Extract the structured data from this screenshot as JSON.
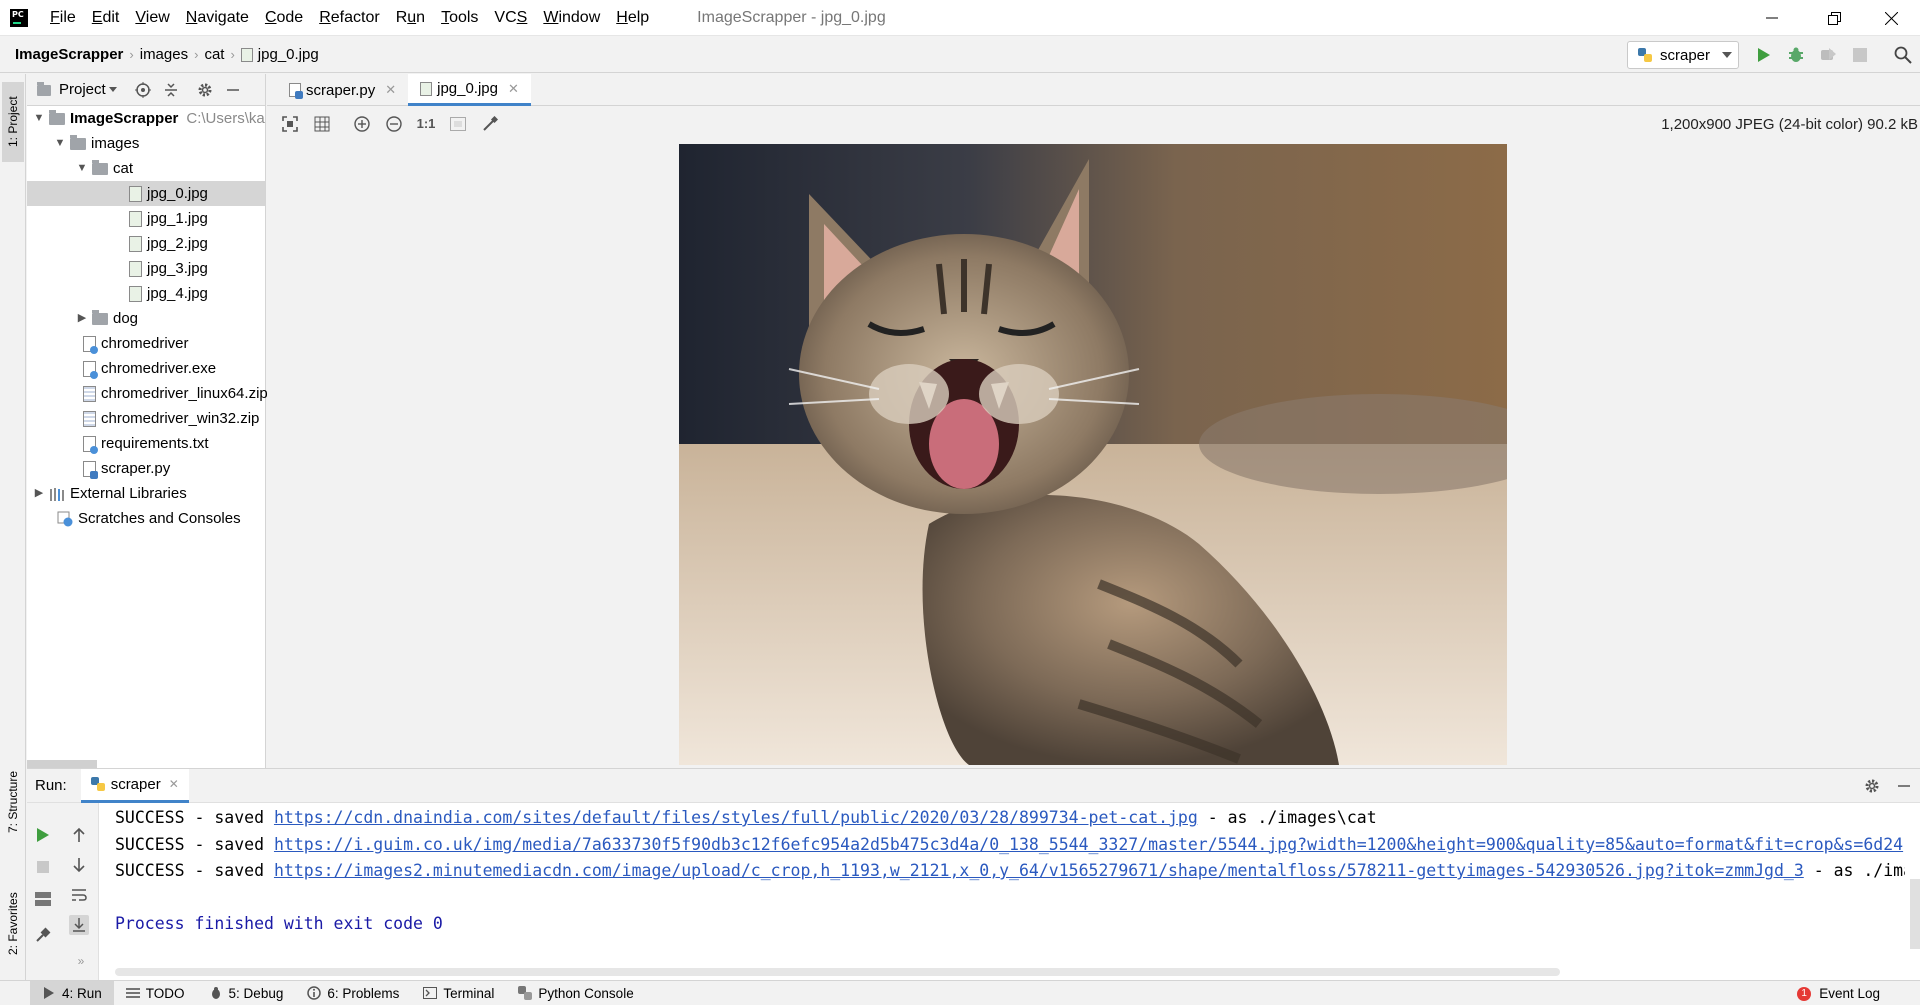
{
  "menu": {
    "items": [
      {
        "label": "File",
        "u": "F"
      },
      {
        "label": "Edit",
        "u": "E"
      },
      {
        "label": "View",
        "u": "V"
      },
      {
        "label": "Navigate",
        "u": "N"
      },
      {
        "label": "Code",
        "u": "C"
      },
      {
        "label": "Refactor",
        "u": "R"
      },
      {
        "label": "Run",
        "u": "u"
      },
      {
        "label": "Tools",
        "u": "T"
      },
      {
        "label": "VCS",
        "u": "S"
      },
      {
        "label": "Window",
        "u": "W"
      },
      {
        "label": "Help",
        "u": "H"
      }
    ],
    "window_title": "ImageScrapper - jpg_0.jpg"
  },
  "breadcrumb": {
    "project": "ImageScrapper",
    "folder1": "images",
    "folder2": "cat",
    "file": "jpg_0.jpg"
  },
  "toolbar": {
    "run_config": "scraper"
  },
  "left_stripe": {
    "project_tab": "1: Project",
    "structure_tab": "7: Structure",
    "favorites_tab": "2: Favorites"
  },
  "project_panel": {
    "title": "Project",
    "root_name": "ImageScrapper",
    "root_path": "C:\\Users\\ka",
    "images": "images",
    "cat": "cat",
    "files": [
      "jpg_0.jpg",
      "jpg_1.jpg",
      "jpg_2.jpg",
      "jpg_3.jpg",
      "jpg_4.jpg"
    ],
    "dog": "dog",
    "chromedriver": "chromedriver",
    "chromedriver_exe": "chromedriver.exe",
    "linux_zip": "chromedriver_linux64.zip",
    "win_zip": "chromedriver_win32.zip",
    "requirements": "requirements.txt",
    "scraper": "scraper.py",
    "external_libraries": "External Libraries",
    "scratches": "Scratches and Consoles"
  },
  "editor_tabs": [
    {
      "label": "scraper.py"
    },
    {
      "label": "jpg_0.jpg"
    }
  ],
  "image_viewer": {
    "zoom_actual": "1:1",
    "info": "1,200x900 JPEG (24-bit color) 90.2 kB"
  },
  "run_panel": {
    "label": "Run:",
    "tab": "scraper",
    "lines": [
      {
        "prefix": "SUCCESS - saved ",
        "url": "https://cdn.dnaindia.com/sites/default/files/styles/full/public/2020/03/28/899734-pet-cat.jpg",
        "suffix": " - as ./images\\cat"
      },
      {
        "prefix": "SUCCESS - saved ",
        "url": "https://i.guim.co.uk/img/media/7a633730f5f90db3c12f6efc954a2d5b475c3d4a/0_138_5544_3327/master/5544.jpg?width=1200&height=900&quality=85&auto=format&fit=crop&s=6d24",
        "suffix": ""
      },
      {
        "prefix": "SUCCESS - saved ",
        "url": "https://images2.minutemediacdn.com/image/upload/c_crop,h_1193,w_2121,x_0,y_64/v1565279671/shape/mentalfloss/578211-gettyimages-542930526.jpg?itok=zmmJgd_3",
        "suffix": " - as ./ima"
      }
    ],
    "exit_message": "Process finished with exit code 0"
  },
  "bottom_bar": {
    "run": "4: Run",
    "todo": "TODO",
    "debug": "5: Debug",
    "problems": "6: Problems",
    "terminal": "Terminal",
    "python_console": "Python Console",
    "event_log": "Event Log",
    "event_count": "1"
  },
  "colors": {
    "accent": "#4083c9",
    "run_green": "#3f9e3f",
    "link": "#2a59bf",
    "selection": "#d5d5d5",
    "error": "#e53935"
  }
}
